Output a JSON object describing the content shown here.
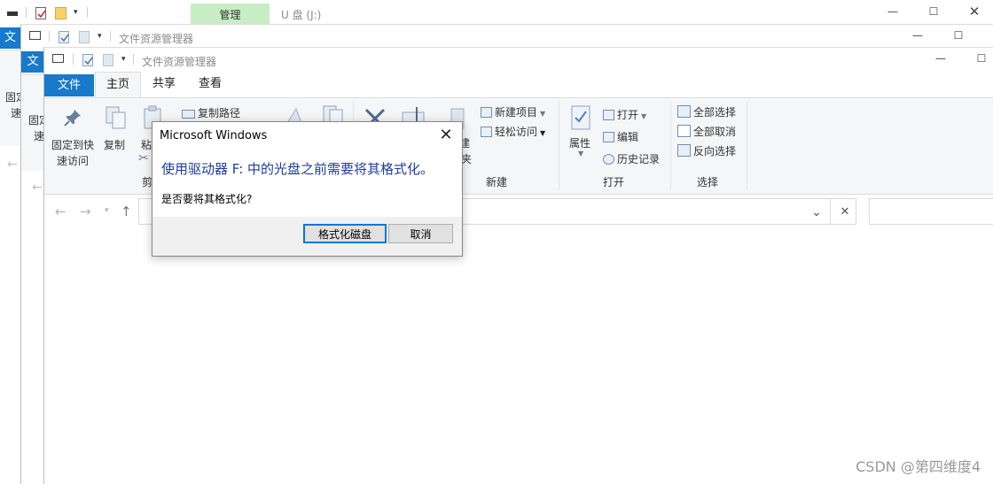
{
  "back_window_1": {
    "manage_tab": "管理",
    "title": "U 盘 (J:)",
    "file_tab": "文",
    "ribbon_fragment_1": "固定",
    "ribbon_fragment_2": "速"
  },
  "back_window_2": {
    "title": "文件资源管理器",
    "file_tab": "文",
    "ribbon_fragment_1": "固定",
    "ribbon_fragment_2": "速"
  },
  "front_window": {
    "title": "文件资源管理器",
    "tabs": {
      "file": "文件",
      "home": "主页",
      "share": "共享",
      "view": "查看"
    },
    "ribbon": {
      "pin_line1": "固定到快",
      "pin_line2": "速访问",
      "copy": "复制",
      "paste_fragment": "粘",
      "copy_path": "复制路径",
      "clipboard_fragment": "剪",
      "new_fragment_1": "建",
      "new_fragment_2": "夹",
      "new_item": "新建项目",
      "easy_access": "轻松访问",
      "new_group": "新建",
      "properties": "属性",
      "open": "打开",
      "edit": "编辑",
      "history": "历史记录",
      "open_group": "打开",
      "select_all": "全部选择",
      "select_none": "全部取消",
      "invert_selection": "反向选择",
      "select_group": "选择"
    }
  },
  "dialog": {
    "title": "Microsoft Windows",
    "message": "使用驱动器 F: 中的光盘之前需要将其格式化。",
    "question": "是否要将其格式化?",
    "format_button": "格式化磁盘",
    "cancel_button": "取消"
  },
  "watermark": "CSDN @第四维度4",
  "colors": {
    "accent": "#1979ca",
    "manage_tab_bg": "#c7eec3",
    "dialog_message": "#1e3ca0"
  }
}
